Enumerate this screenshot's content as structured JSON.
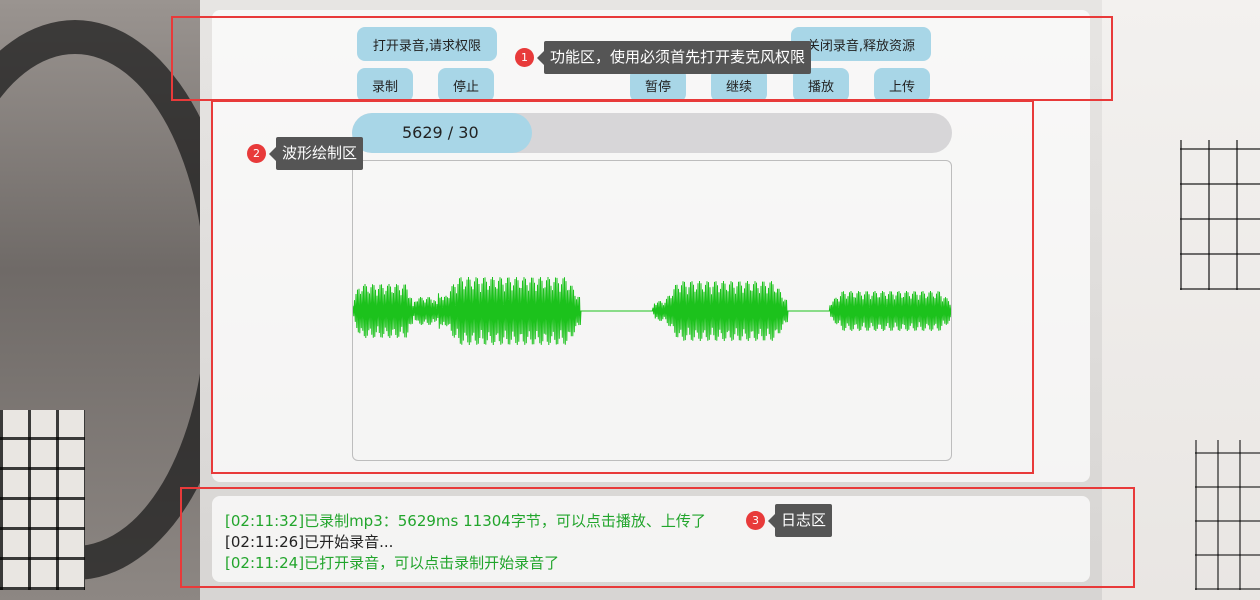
{
  "controls": {
    "open_button": "打开录音,请求权限",
    "close_button": "关闭录音,释放资源",
    "record_button": "录制",
    "stop_button": "停止",
    "pause_button": "暂停",
    "resume_button": "继续",
    "play_button": "播放",
    "upload_button": "上传"
  },
  "progress": {
    "text": "5629 / 30"
  },
  "waveform": {
    "color": "#1cc21c"
  },
  "log": {
    "lines": [
      {
        "text": "[02:11:32]已录制mp3：5629ms 11304字节，可以点击播放、上传了",
        "color": "#22a52c"
      },
      {
        "text": "[02:11:26]已开始录音...",
        "color": "#222222"
      },
      {
        "text": "[02:11:24]已打开录音，可以点击录制开始录音了",
        "color": "#22a52c"
      }
    ]
  },
  "annotations": [
    {
      "badge": "1",
      "label": "功能区，使用必须首先打开麦克风权限"
    },
    {
      "badge": "2",
      "label": "波形绘制区"
    },
    {
      "badge": "3",
      "label": "日志区"
    }
  ],
  "colors": {
    "button_bg": "#a8d6e7",
    "annotation_red": "#e83a3a",
    "tooltip_bg": "#555555"
  }
}
